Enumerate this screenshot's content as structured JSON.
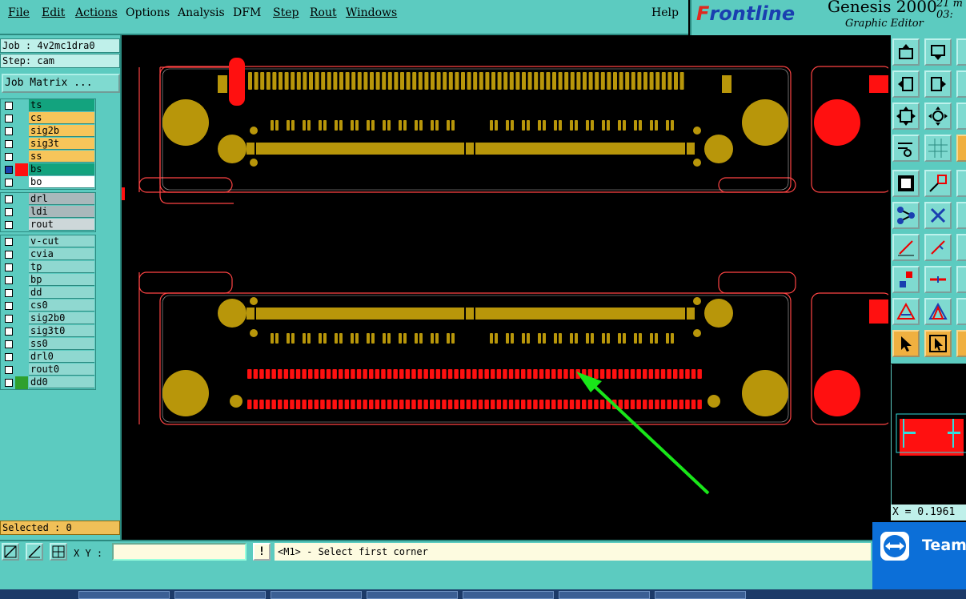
{
  "menu": {
    "items": [
      "File",
      "Edit",
      "Actions",
      "Options",
      "Analysis",
      "DFM",
      "Step",
      "Rout",
      "Windows"
    ],
    "help": "Help"
  },
  "brand": {
    "logo_pre": "F",
    "logo_rest": "rontline",
    "title": "Genesis 2000",
    "subtitle": "Graphic Editor",
    "clock_line1": "21 m",
    "clock_line2": "03:"
  },
  "job": {
    "job_label": "Job : 4v2mc1dra0",
    "step_label": "Step: cam",
    "matrix_button": "Job Matrix ..."
  },
  "layers": {
    "group1": [
      {
        "name": "ts",
        "color": "#13a37e"
      },
      {
        "name": "cs",
        "color": "#f7c55a"
      },
      {
        "name": "sig2b",
        "color": "#f7c55a"
      },
      {
        "name": "sig3t",
        "color": "#f7c55a"
      },
      {
        "name": "ss",
        "color": "#f7c55a"
      },
      {
        "name": "bs",
        "color": "#13a37e"
      },
      {
        "name": "bo",
        "color": "#ffffff"
      }
    ],
    "group2": [
      {
        "name": "drl",
        "color": "#a9b8bb"
      },
      {
        "name": "ldi",
        "color": "#a9b8bb"
      },
      {
        "name": "rout",
        "color": "#cdd7d9"
      }
    ],
    "group3": [
      {
        "name": "v-cut",
        "color": "#8fd8d0"
      },
      {
        "name": "cvia",
        "color": "#8fd8d0"
      },
      {
        "name": "tp",
        "color": "#8fd8d0"
      },
      {
        "name": "bp",
        "color": "#8fd8d0"
      },
      {
        "name": "dd",
        "color": "#8fd8d0"
      },
      {
        "name": "cs0",
        "color": "#8fd8d0"
      },
      {
        "name": "sig2b0",
        "color": "#8fd8d0"
      },
      {
        "name": "sig3t0",
        "color": "#8fd8d0"
      },
      {
        "name": "ss0",
        "color": "#8fd8d0"
      },
      {
        "name": "drl0",
        "color": "#8fd8d0"
      },
      {
        "name": "rout0",
        "color": "#8fd8d0"
      },
      {
        "name": "dd0",
        "color": "#8fd8d0"
      }
    ]
  },
  "selected": "Selected : 0",
  "coords": {
    "x_readout": "X = 0.1961"
  },
  "bottom": {
    "xy_label": "X Y :",
    "xy_value": "",
    "excl": "!",
    "status": "<M1> - Select first corner"
  },
  "teamviewer": {
    "name": "Team"
  },
  "colors": {
    "gold": "#b8960a",
    "red": "#ff1010",
    "outline": "#ff4444",
    "arrow": "#19e619"
  },
  "icons": [
    "open-icon",
    "save-icon",
    "zoom-fit-icon",
    "zoom-home-icon",
    "measure-icon",
    "grid-icon",
    "select-icon",
    "add-feature-icon",
    "snap-icon",
    "cross-icon",
    "line-icon",
    "arc-icon",
    "pad-icon",
    "move-icon",
    "triangle-icon",
    "pointer-icon"
  ]
}
